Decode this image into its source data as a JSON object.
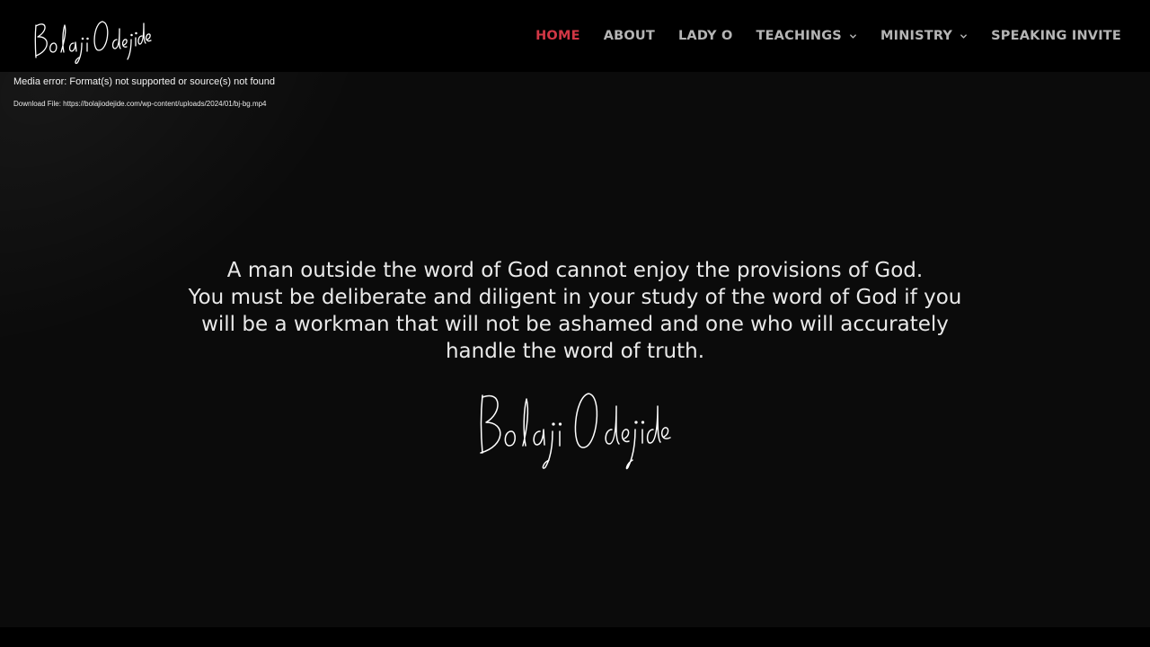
{
  "header": {
    "logo_text": "Bolaji Odejide",
    "nav": [
      {
        "label": "HOME",
        "active": true,
        "has_dropdown": false
      },
      {
        "label": "ABOUT",
        "active": false,
        "has_dropdown": false
      },
      {
        "label": "LADY O",
        "active": false,
        "has_dropdown": false
      },
      {
        "label": "TEACHINGS",
        "active": false,
        "has_dropdown": true
      },
      {
        "label": "MINISTRY",
        "active": false,
        "has_dropdown": true
      },
      {
        "label": "SPEAKING INVITE",
        "active": false,
        "has_dropdown": false
      }
    ]
  },
  "media": {
    "error_text": "Media error: Format(s) not supported or source(s) not found",
    "download_label": "Download File: ",
    "download_url": "https://bolajiodejide.com/wp-content/uploads/2024/01/bj-bg.mp4"
  },
  "hero": {
    "quote_line1": "A man outside the word of God cannot enjoy the provisions of God.",
    "quote_line2": "You must be deliberate and diligent in your study of the word of God if you will be a workman that will not be ashamed and one who will accurately handle the word of truth.",
    "signature_text": "Bolaji Odejide"
  },
  "colors": {
    "background": "#0b0b0b",
    "header_background": "#000000",
    "nav_text": "#b5b5b5",
    "nav_active": "#d23745",
    "text": "#e9e9e9"
  },
  "icons": {
    "dropdown": "chevron-down-icon"
  }
}
